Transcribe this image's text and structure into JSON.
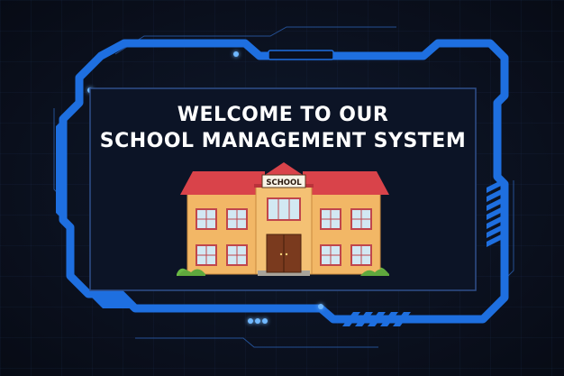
{
  "welcome": {
    "line1": "WELCOME TO OUR",
    "line2": "SCHOOL MANAGEMENT SYSTEM"
  },
  "illustration": {
    "sign_text": "SCHOOL",
    "icon": "school-building-icon"
  },
  "colors": {
    "background": "#0a0f1c",
    "frame_blue": "#1e6fe0",
    "frame_glow": "#5aa9ff",
    "inner_border": "#2f4f8a",
    "roof": "#d9434a",
    "wall": "#f2b766",
    "door": "#7a3a1e",
    "window": "#d2e8f3",
    "grass": "#6ab945"
  }
}
